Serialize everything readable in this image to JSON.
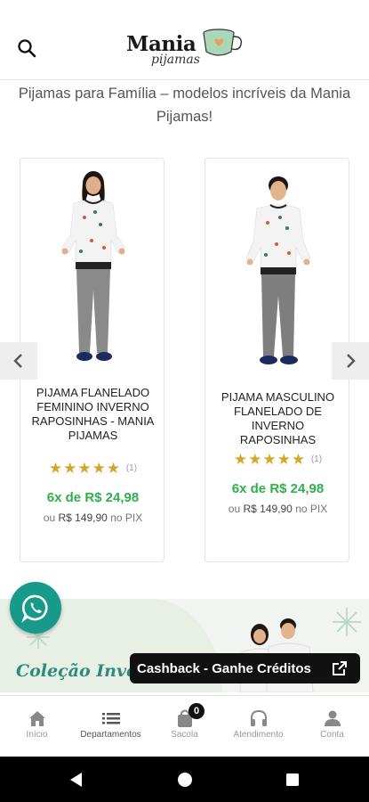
{
  "header": {
    "logo_main": "Mania",
    "logo_sub": "pijamas"
  },
  "intro": {
    "text": "Pijamas para Família – modelos incríveis da Mania Pijamas!"
  },
  "products": [
    {
      "name": "PIJAMA FLANELADO FEMININO INVERNO RAPOSINHAS - MANIA PIJAMAS",
      "rating": 5,
      "stars": "★★★★★",
      "review_count": "(1)",
      "installments": "6x de R$ 24,98",
      "pix_prefix": "ou",
      "pix_price": "R$ 149,90",
      "pix_suffix": "no PIX"
    },
    {
      "name": "PIJAMA MASCULINO FLANELADO DE INVERNO RAPOSINHAS",
      "rating": 5,
      "stars": "★★★★★",
      "review_count": "(1)",
      "installments": "6x de R$ 24,98",
      "pix_prefix": "ou",
      "pix_price": "R$ 149,90",
      "pix_suffix": "no PIX"
    }
  ],
  "banner": {
    "title": "Coleção Inver"
  },
  "cashback": {
    "label": "Cashback - Ganhe Créditos"
  },
  "bottom_nav": {
    "items": [
      {
        "label": "Início",
        "icon": "home-icon"
      },
      {
        "label": "Departamentos",
        "icon": "menu-icon"
      },
      {
        "label": "Sacola",
        "icon": "bag-icon",
        "badge": "0"
      },
      {
        "label": "Atendimento",
        "icon": "headset-icon"
      },
      {
        "label": "Conta",
        "icon": "user-icon"
      }
    ]
  },
  "colors": {
    "accent_green": "#2eb14a",
    "star": "#d4a72c",
    "whatsapp": "#179a8a",
    "banner_text": "#2c8b7a"
  }
}
